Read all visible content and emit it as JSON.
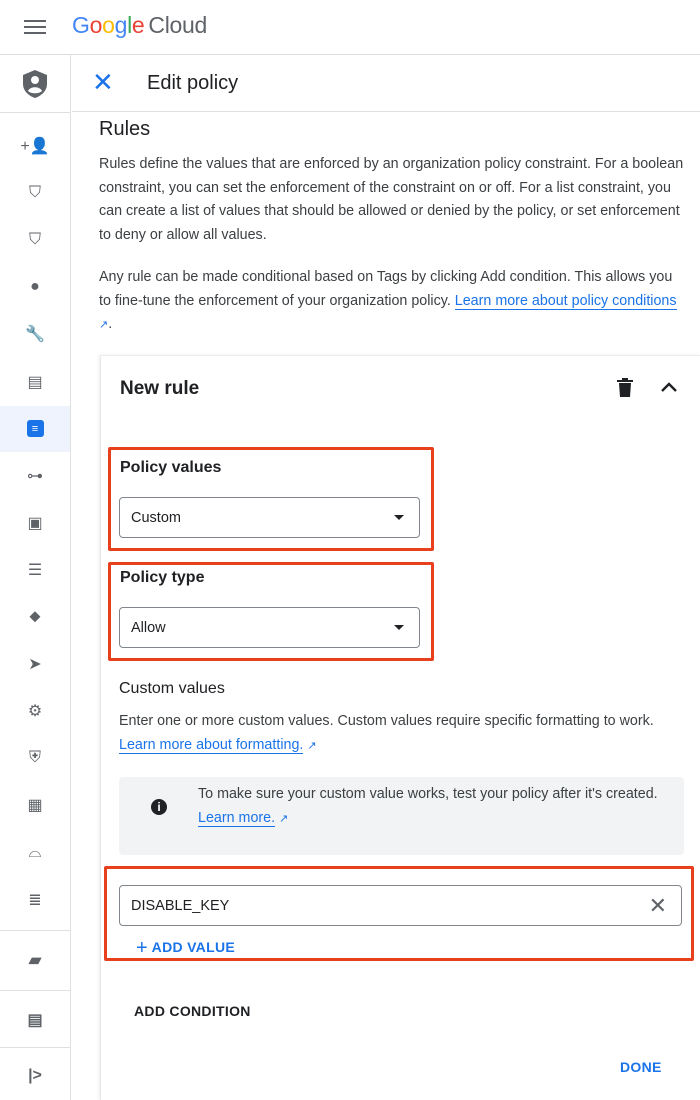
{
  "header": {
    "logo_google": "Google",
    "logo_cloud": "Cloud"
  },
  "page": {
    "title": "Edit policy"
  },
  "sidebar": {
    "items": [
      {
        "icon": "add-person-icon",
        "glyph": "+👤"
      },
      {
        "icon": "shield-key-icon",
        "glyph": "⛉"
      },
      {
        "icon": "shield-person-icon",
        "glyph": "⛉"
      },
      {
        "icon": "account-circle-icon",
        "glyph": "●"
      },
      {
        "icon": "wrench-icon",
        "glyph": "🔧"
      },
      {
        "icon": "document-settings-icon",
        "glyph": "▤"
      },
      {
        "icon": "policy-document-icon",
        "glyph": "≡",
        "selected": true
      },
      {
        "icon": "key-box-icon",
        "glyph": "⊶"
      },
      {
        "icon": "id-card-icon",
        "glyph": "▣"
      },
      {
        "icon": "list-icon",
        "glyph": "☰"
      },
      {
        "icon": "tag-icon",
        "glyph": "⬥"
      },
      {
        "icon": "label-icon",
        "glyph": "➤"
      },
      {
        "icon": "gear-icon",
        "glyph": "⚙"
      },
      {
        "icon": "security-shield-icon",
        "glyph": "⛨"
      },
      {
        "icon": "filmstrip-icon",
        "glyph": "▦"
      },
      {
        "icon": "incognito-icon",
        "glyph": "⌓"
      },
      {
        "icon": "stacked-lines-icon",
        "glyph": "≣"
      }
    ],
    "bottom_items": [
      {
        "icon": "folder-settings-icon",
        "glyph": "▰"
      },
      {
        "icon": "release-notes-icon",
        "glyph": "▤"
      },
      {
        "icon": "expand-sidebar-icon",
        "glyph": "|>"
      }
    ]
  },
  "rules": {
    "heading": "Rules",
    "description": "Rules define the values that are enforced by an organization policy constraint. For a boolean constraint, you can set the enforcement of the constraint on or off. For a list constraint, you can create a list of values that should be allowed or denied by the policy, or set enforcement to deny or allow all values.",
    "conditional_text": "Any rule can be made conditional based on Tags by clicking Add condition. This allows you to fine-tune the enforcement of your organization policy. ",
    "conditional_link": "Learn more about policy conditions",
    "period": "."
  },
  "new_rule": {
    "title": "New rule",
    "policy_values_label": "Policy values",
    "policy_values_selected": "Custom",
    "policy_type_label": "Policy type",
    "policy_type_selected": "Allow",
    "custom_values_label": "Custom values",
    "custom_values_help": "Enter one or more custom values. Custom values require specific formatting to work. ",
    "formatting_link": "Learn more about formatting.",
    "info_text": "To make sure your custom value works, test your policy after it's created.",
    "info_link": "Learn more.",
    "custom_value": "DISABLE_KEY",
    "add_value": "ADD VALUE",
    "add_condition": "ADD CONDITION",
    "done": "DONE"
  },
  "colors": {
    "accent": "#1a73e8",
    "highlight_box": "#e8401c"
  }
}
